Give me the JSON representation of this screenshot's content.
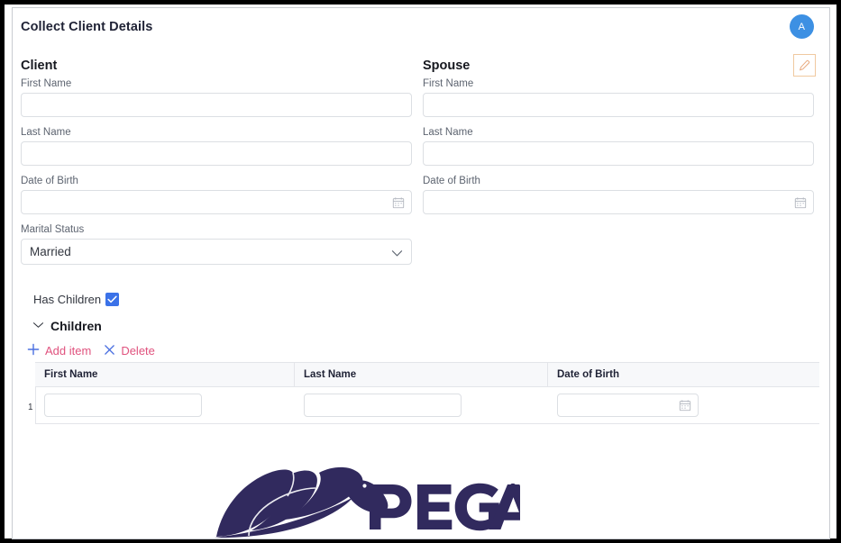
{
  "header": {
    "title": "Collect Client Details",
    "avatar_initial": "A",
    "edit_icon": "pencil-icon"
  },
  "colors": {
    "accent_blue": "#3b72e8",
    "avatar_blue": "#3d90e3",
    "link_pink": "#e0527e",
    "icon_blue": "#4a6fe0",
    "edit_border_orange": "#f0c9a0",
    "logo_navy": "#312a5e",
    "label_gray": "#5d6470",
    "border_gray": "#dcdfe3",
    "table_header_bg": "#f7f8fa"
  },
  "client": {
    "heading": "Client",
    "fields": [
      {
        "label": "First Name",
        "value": "",
        "type": "text"
      },
      {
        "label": "Last Name",
        "value": "",
        "type": "text"
      },
      {
        "label": "Date of Birth",
        "value": "",
        "type": "date",
        "icon": "calendar-icon"
      }
    ],
    "marital_status": {
      "label": "Marital Status",
      "value": "Married",
      "icon": "chevron-down-icon",
      "options": [
        "Married"
      ]
    }
  },
  "spouse": {
    "heading": "Spouse",
    "fields": [
      {
        "label": "First Name",
        "value": "",
        "type": "text"
      },
      {
        "label": "Last Name",
        "value": "",
        "type": "text"
      },
      {
        "label": "Date of Birth",
        "value": "",
        "type": "date",
        "icon": "calendar-icon"
      }
    ]
  },
  "has_children": {
    "label": "Has Children",
    "checked": true,
    "icon": "check-icon"
  },
  "children_group": {
    "title": "Children",
    "collapse_icon": "chevron-down-icon",
    "expanded": true,
    "actions": [
      {
        "label": "Add item",
        "glyph": "+",
        "icon": "plus-icon"
      },
      {
        "label": "Delete",
        "glyph": "×",
        "icon": "close-x-icon"
      }
    ],
    "table": {
      "columns": [
        "First Name",
        "Last Name",
        "Date of Birth"
      ],
      "rows": [
        {
          "number": "1",
          "first_name": "",
          "last_name": "",
          "date_of_birth": "",
          "date_icon": "calendar-icon"
        }
      ]
    }
  },
  "footer": {
    "logo_text": "PEGA",
    "logo_trademark": "®",
    "logo_mark": "pega-horse-logo"
  }
}
